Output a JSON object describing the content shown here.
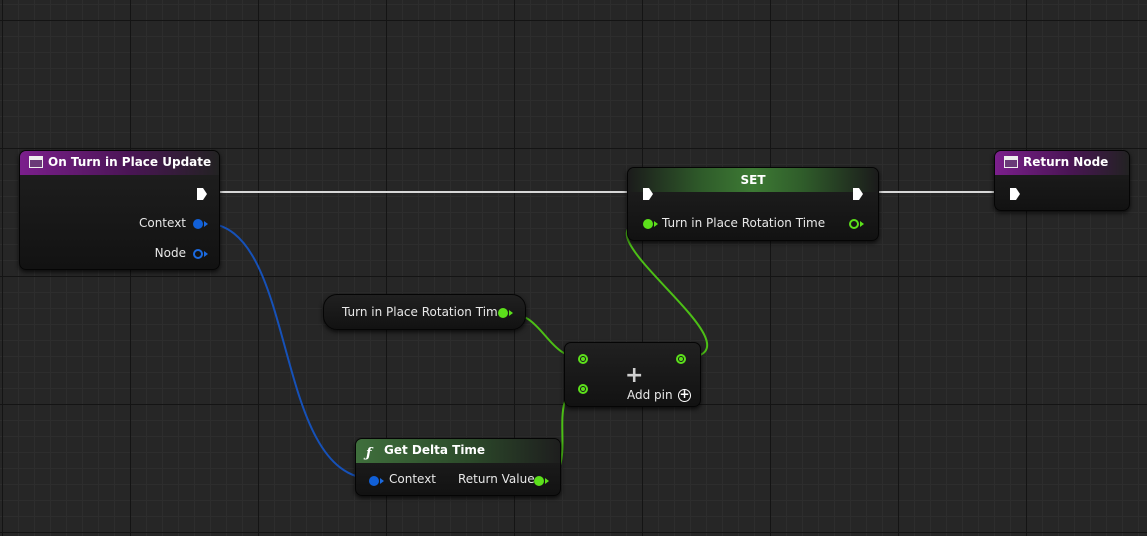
{
  "nodes": {
    "event": {
      "title": "On Turn in Place Update",
      "context_label": "Context",
      "node_label": "Node"
    },
    "set": {
      "title": "SET",
      "var_label": "Turn in Place Rotation Time"
    },
    "return": {
      "title": "Return Node"
    },
    "var_get": {
      "label": "Turn in Place Rotation Time"
    },
    "add": {
      "add_pin_label": "Add pin"
    },
    "delta": {
      "title": "Get Delta Time",
      "context_label": "Context",
      "return_label": "Return Value"
    }
  },
  "colors": {
    "exec": "#ffffff",
    "object_pin": "#1b6ae0",
    "float_pin": "#5ce01b",
    "event_header": "#7b1f8c"
  },
  "icons": {
    "event": "event-node-icon",
    "function": "function-icon",
    "add": "plus-icon",
    "add_pin": "add-circle-icon"
  }
}
